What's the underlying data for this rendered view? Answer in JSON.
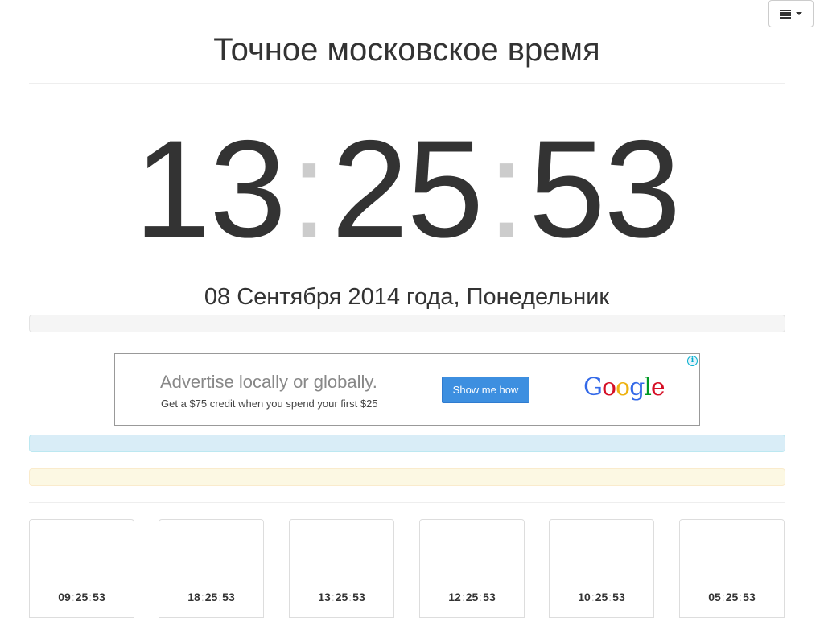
{
  "menu": {
    "icon": "list-icon",
    "caret_icon": "caret-down-icon"
  },
  "title": "Точное московское время",
  "clock": {
    "hours": "13",
    "minutes": "25",
    "seconds": "53",
    "separator": ":"
  },
  "date": "08 Сентября 2014 года, Понедельник",
  "ad": {
    "headline": "Advertise locally or globally.",
    "subline": "Get a $75 credit when you spend your first $25",
    "button": "Show me how",
    "logo": [
      "G",
      "o",
      "o",
      "g",
      "l",
      "e"
    ],
    "logo_colors": [
      "#3369e8",
      "#d50f25",
      "#eeb211",
      "#3369e8",
      "#009925",
      "#d50f25"
    ],
    "info_glyph": "i"
  },
  "cities": [
    {
      "hours": "09",
      "minutes": "25",
      "seconds": "53"
    },
    {
      "hours": "18",
      "minutes": "25",
      "seconds": "53"
    },
    {
      "hours": "13",
      "minutes": "25",
      "seconds": "53"
    },
    {
      "hours": "12",
      "minutes": "25",
      "seconds": "53"
    },
    {
      "hours": "10",
      "minutes": "25",
      "seconds": "53"
    },
    {
      "hours": "05",
      "minutes": "25",
      "seconds": "53"
    }
  ],
  "colors": {
    "text": "#333333",
    "separator": "#cccccc",
    "info_bar": "#d9edf7",
    "warning_bar": "#fcf8e3",
    "well_bar": "#f5f5f5",
    "ad_button": "#3d8fe0"
  }
}
